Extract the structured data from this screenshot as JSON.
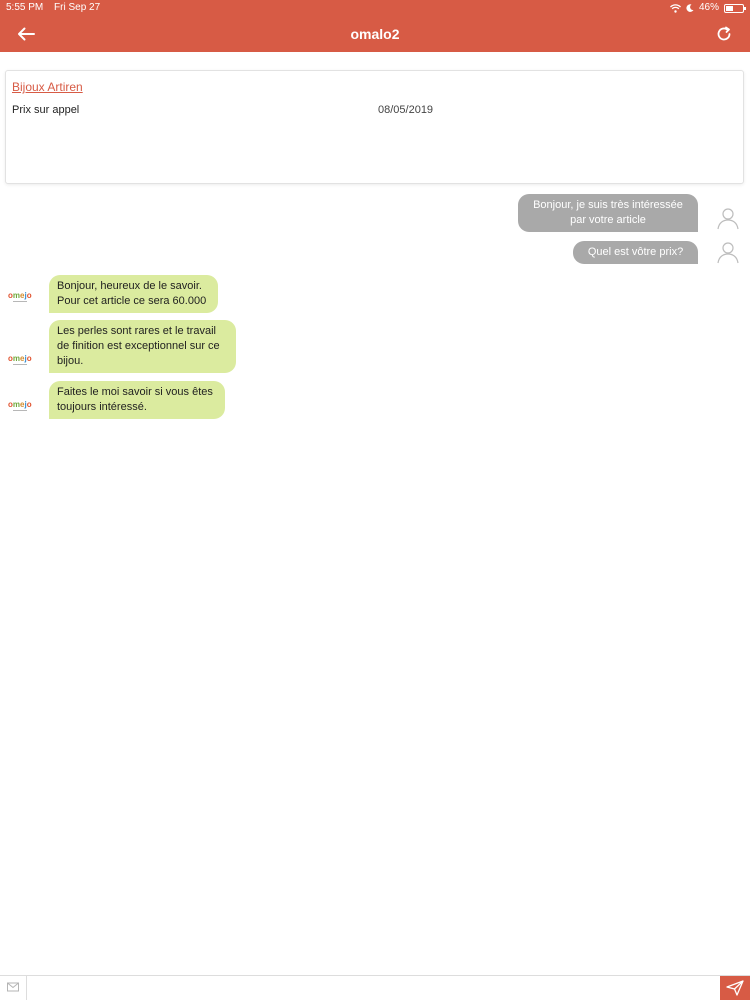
{
  "status_bar": {
    "time": "5:55 PM",
    "date": "Fri Sep 27",
    "battery": "46%",
    "battery_level": 0.46,
    "icons": [
      "wifi-icon",
      "moon-icon",
      "battery-icon"
    ]
  },
  "header": {
    "title": "omalo2",
    "back_icon": "arrow-left-icon",
    "refresh_icon": "refresh-icon",
    "color": "#d75b45"
  },
  "product": {
    "name": "Bijoux Artiren",
    "price": "Prix sur appel",
    "date": "08/05/2019"
  },
  "messages": [
    {
      "direction": "out",
      "lines": [
        "Bonjour, je suis très intéressée",
        "par votre article"
      ]
    },
    {
      "direction": "out",
      "lines": [
        "Quel est vôtre prix?"
      ]
    },
    {
      "direction": "in",
      "lines": [
        "Bonjour, heureux de le savoir.",
        "Pour cet article ce sera 60.000"
      ]
    },
    {
      "direction": "in",
      "lines": [
        "Les perles sont rares et le travail",
        "de finition est exceptionnel sur ce",
        "bijou."
      ]
    },
    {
      "direction": "in",
      "lines": [
        "Faites le moi savoir si vous êtes",
        "toujours intéressé."
      ]
    }
  ],
  "colors": {
    "outgoing_bubble": "#a9a9a9",
    "incoming_bubble": "#dbeb9f",
    "accent": "#d75b45"
  },
  "composer": {
    "placeholder": "",
    "value": "",
    "mail_icon": "mail-icon",
    "send_icon": "send-icon"
  }
}
